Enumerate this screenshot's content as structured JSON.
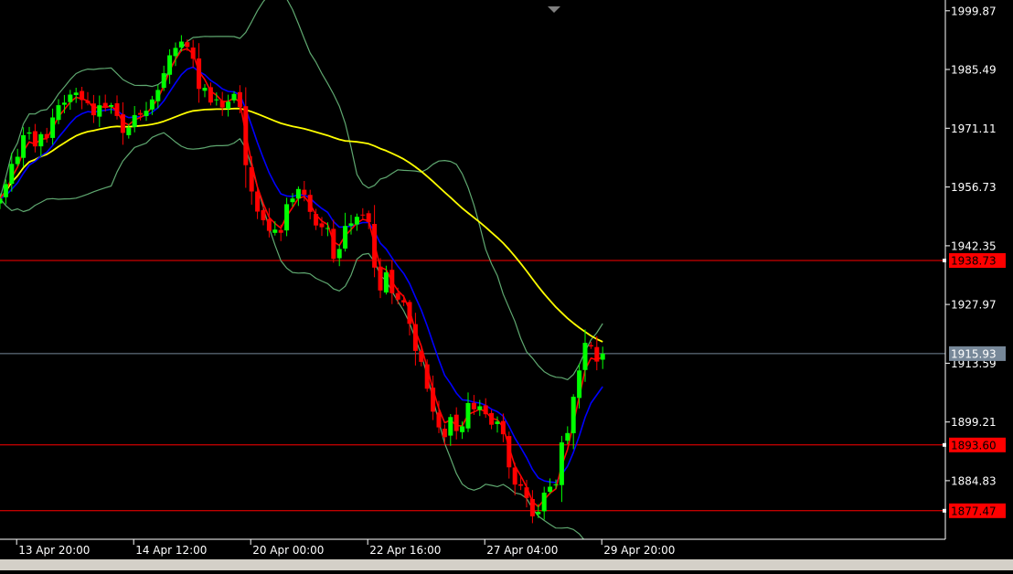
{
  "chart_data": {
    "type": "candlestick",
    "colors": {
      "background": "#000000",
      "frame": "#ffffff",
      "text": "#ffffff",
      "bull": "#00ff00",
      "bear": "#ff0000",
      "bollinger": "#5fa870",
      "ma_fast": "#ff0000",
      "ma_slow": "#0000ff",
      "ma_long": "#ffff00",
      "level_line": "#ff0000",
      "level_label_bg": "#ff0000",
      "current_line": "#778899",
      "current_label_bg": "#778899"
    },
    "y_axis": {
      "range": [
        1870.5,
        2002.5
      ],
      "ticks": [
        {
          "value": 1999.87,
          "label": "1999.87"
        },
        {
          "value": 1985.49,
          "label": "1985.49"
        },
        {
          "value": 1971.11,
          "label": "1971.11"
        },
        {
          "value": 1956.73,
          "label": "1956.73"
        },
        {
          "value": 1942.35,
          "label": "1942.35"
        },
        {
          "value": 1927.97,
          "label": "1927.97"
        },
        {
          "value": 1913.59,
          "label": "1913.59"
        },
        {
          "value": 1899.21,
          "label": "1899.21"
        },
        {
          "value": 1884.83,
          "label": "1884.83"
        }
      ]
    },
    "x_axis": {
      "bar_count": 100,
      "ticks": [
        {
          "index": 3,
          "label": "13 Apr 20:00"
        },
        {
          "index": 23,
          "label": "14 Apr 12:00"
        },
        {
          "index": 43,
          "label": "20 Apr 00:00"
        },
        {
          "index": 63,
          "label": "22 Apr 16:00"
        },
        {
          "index": 83,
          "label": "27 Apr 04:00"
        },
        {
          "index": 103,
          "label": "29 Apr 20:00"
        }
      ]
    },
    "levels": [
      {
        "value": 1938.73,
        "label": "1938.73"
      },
      {
        "value": 1893.6,
        "label": "1893.60"
      },
      {
        "value": 1877.47,
        "label": "1877.47"
      }
    ],
    "current_price": {
      "value": 1915.93,
      "label": "1915.93"
    },
    "close": [
      1953.91,
      1957.43,
      1962.38,
      1964.12,
      1969.4,
      1970.09,
      1966.66,
      1969.65,
      1968.7,
      1973.74,
      1976.76,
      1977.38,
      1979.35,
      1979.83,
      1978.02,
      1977.27,
      1974.28,
      1976.73,
      1976.11,
      1976.77,
      1974.09,
      1969.97,
      1971.23,
      1974.33,
      1974.41,
      1975.38,
      1978.16,
      1980.49,
      1984.57,
      1988.96,
      1990.78,
      1992.32,
      1990.99,
      1988.13,
      1980.74,
      1980.99,
      1977.39,
      1978.17,
      1976.18,
      1977.6,
      1979.52,
      1976.33,
      1962.06,
      1955.62,
      1950.69,
      1948.6,
      1945.97,
      1946.29,
      1945.51,
      1952.51,
      1953.9,
      1956.23,
      1954.81,
      1950.64,
      1947.32,
      1946.88,
      1946.68,
      1939.16,
      1941.56,
      1947.2,
      1947.82,
      1949.43,
      1949.75,
      1948.13,
      1937.01,
      1931.42,
      1935.86,
      1930.71,
      1929.15,
      1928.46,
      1923.22,
      1916.61,
      1913.92,
      1907.35,
      1901.74,
      1897.89,
      1895.49,
      1900.41,
      1896.99,
      1898.13,
      1903.84,
      1902.31,
      1903.05,
      1901.09,
      1898.54,
      1899.31,
      1896.2,
      1888.11,
      1883.88,
      1883.6,
      1880.62,
      1876.11,
      1877.21,
      1881.92,
      1883.37,
      1883.93,
      1894.21,
      1896.5,
      1905.37,
      1911.83,
      1918.58,
      1917.72,
      1913.99,
      1915.93
    ]
  }
}
